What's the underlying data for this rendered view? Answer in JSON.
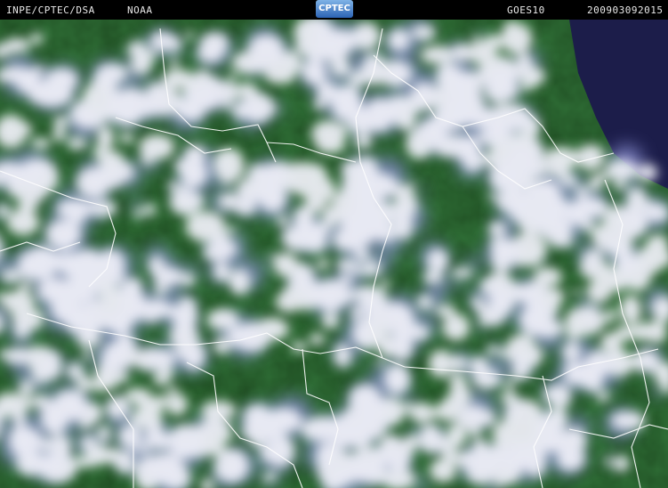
{
  "header": {
    "agency": "INPE/CPTEC/DSA",
    "source": "NOAA",
    "logo_text": "CPTEC",
    "satellite": "GOES10",
    "timestamp": "200903092015"
  },
  "colors": {
    "header_background": "#000000",
    "header_text": "#e8e8e8",
    "land_vegetation": "#1f4d22",
    "cloud": "#f2f2fa",
    "cloud_edge": "#8f94d8",
    "ocean_night": "#1c1d4a",
    "borders": "#ffffff"
  }
}
